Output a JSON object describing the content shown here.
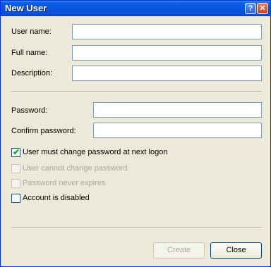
{
  "window": {
    "title": "New User",
    "help_glyph": "?",
    "close_glyph": "✕"
  },
  "fields": {
    "username": {
      "label": "User name:",
      "value": ""
    },
    "fullname": {
      "label": "Full name:",
      "value": ""
    },
    "description": {
      "label": "Description:",
      "value": ""
    },
    "password": {
      "label": "Password:",
      "value": ""
    },
    "confirm": {
      "label": "Confirm password:",
      "value": ""
    }
  },
  "options": [
    {
      "label": "User must change password at next logon",
      "checked": true,
      "enabled": true
    },
    {
      "label": "User cannot change password",
      "checked": false,
      "enabled": false
    },
    {
      "label": "Password never expires",
      "checked": false,
      "enabled": false
    },
    {
      "label": "Account is disabled",
      "checked": false,
      "enabled": true
    }
  ],
  "buttons": {
    "create_label": "Create",
    "close_label": "Close"
  },
  "icons": {
    "help": "help-icon",
    "close": "close-icon",
    "check": "checkmark-icon"
  }
}
